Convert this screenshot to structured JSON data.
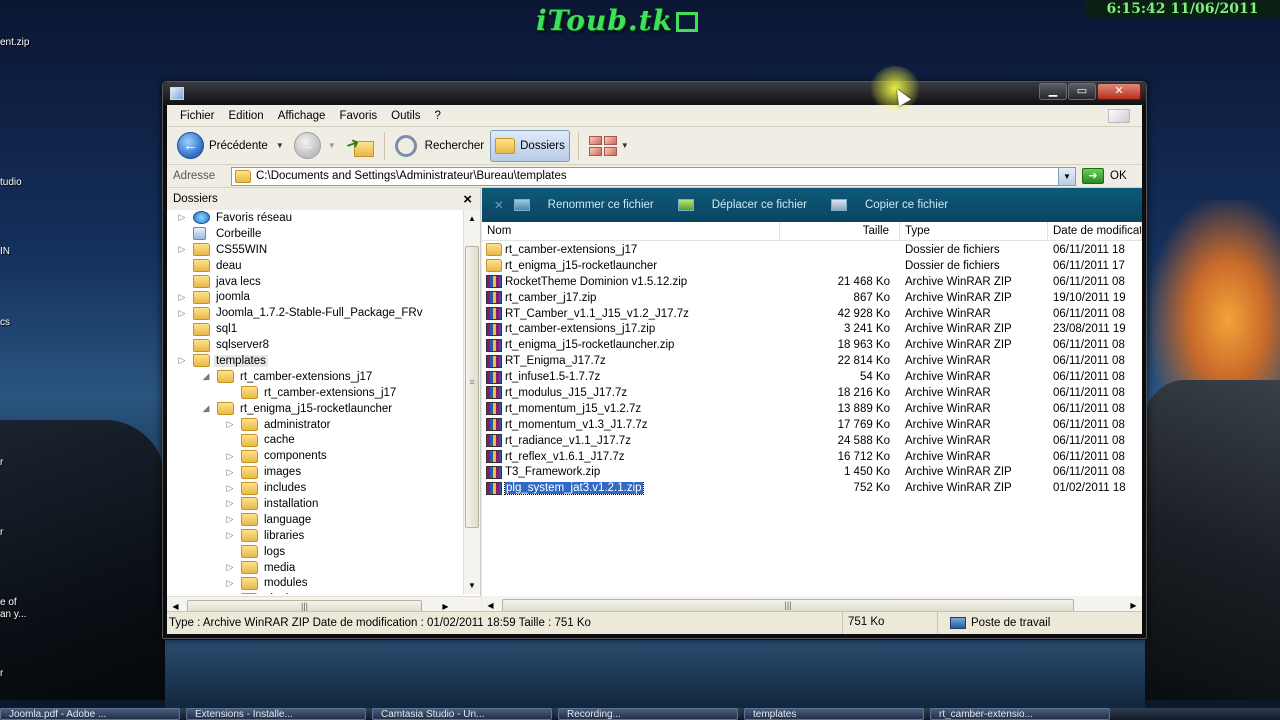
{
  "overlay": {
    "brand": "iToub.tk",
    "clock": "6:15:42  11/06/2011"
  },
  "desktop_labels": [
    "ent.zip",
    "tudio",
    "IN",
    "cs",
    "r",
    "r",
    "r",
    "e of",
    "an y...",
    "r"
  ],
  "window": {
    "menu": [
      "Fichier",
      "Edition",
      "Affichage",
      "Favoris",
      "Outils",
      "?"
    ],
    "toolbar": {
      "back": "Précédente",
      "search": "Rechercher",
      "folders": "Dossiers"
    },
    "address": {
      "label": "Adresse",
      "path": "C:\\Documents and Settings\\Administrateur\\Bureau\\templates",
      "go": "OK"
    },
    "left_pane": {
      "title": "Dossiers",
      "close": "×",
      "tree": [
        {
          "label": "Favoris réseau",
          "depth": 0,
          "exp": "▷",
          "icon": "net"
        },
        {
          "label": "Corbeille",
          "depth": 0,
          "exp": "",
          "icon": "bin"
        },
        {
          "label": "CS55WIN",
          "depth": 0,
          "exp": "▷",
          "icon": "folder"
        },
        {
          "label": "deau",
          "depth": 0,
          "exp": "",
          "icon": "folder"
        },
        {
          "label": "java lecs",
          "depth": 0,
          "exp": "",
          "icon": "folder"
        },
        {
          "label": "joomla",
          "depth": 0,
          "exp": "▷",
          "icon": "folder"
        },
        {
          "label": "Joomla_1.7.2-Stable-Full_Package_FRv",
          "depth": 0,
          "exp": "▷",
          "icon": "folder"
        },
        {
          "label": "sql1",
          "depth": 0,
          "exp": "",
          "icon": "folder"
        },
        {
          "label": "sqlserver8",
          "depth": 0,
          "exp": "",
          "icon": "folder"
        },
        {
          "label": "templates",
          "depth": 0,
          "exp": "▷",
          "icon": "folder",
          "selected": true
        },
        {
          "label": "rt_camber-extensions_j17",
          "depth": 1,
          "exp": "◢",
          "icon": "folder"
        },
        {
          "label": "rt_camber-extensions_j17",
          "depth": 2,
          "exp": "",
          "icon": "folder"
        },
        {
          "label": "rt_enigma_j15-rocketlauncher",
          "depth": 1,
          "exp": "◢",
          "icon": "folder"
        },
        {
          "label": "administrator",
          "depth": 2,
          "exp": "▷",
          "icon": "folder"
        },
        {
          "label": "cache",
          "depth": 2,
          "exp": "",
          "icon": "folder"
        },
        {
          "label": "components",
          "depth": 2,
          "exp": "▷",
          "icon": "folder"
        },
        {
          "label": "images",
          "depth": 2,
          "exp": "▷",
          "icon": "folder"
        },
        {
          "label": "includes",
          "depth": 2,
          "exp": "▷",
          "icon": "folder"
        },
        {
          "label": "installation",
          "depth": 2,
          "exp": "▷",
          "icon": "folder"
        },
        {
          "label": "language",
          "depth": 2,
          "exp": "▷",
          "icon": "folder"
        },
        {
          "label": "libraries",
          "depth": 2,
          "exp": "▷",
          "icon": "folder"
        },
        {
          "label": "logs",
          "depth": 2,
          "exp": "",
          "icon": "folder"
        },
        {
          "label": "media",
          "depth": 2,
          "exp": "▷",
          "icon": "folder"
        },
        {
          "label": "modules",
          "depth": 2,
          "exp": "▷",
          "icon": "folder"
        },
        {
          "label": "plugins",
          "depth": 2,
          "exp": "▷",
          "icon": "folder"
        }
      ]
    },
    "tasks": {
      "rename": "Renommer ce fichier",
      "move": "Déplacer ce fichier",
      "copy": "Copier ce fichier"
    },
    "columns": {
      "name": "Nom",
      "size": "Taille",
      "type": "Type",
      "date": "Date de modificatio"
    },
    "files": [
      {
        "name": "rt_camber-extensions_j17",
        "size": "",
        "type": "Dossier de fichiers",
        "date": "06/11/2011 18",
        "icon": "folder"
      },
      {
        "name": "rt_enigma_j15-rocketlauncher",
        "size": "",
        "type": "Dossier de fichiers",
        "date": "06/11/2011 17",
        "icon": "folder"
      },
      {
        "name": "RocketTheme Dominion v1.5.12.zip",
        "size": "21 468 Ko",
        "type": "Archive WinRAR ZIP",
        "date": "06/11/2011 08",
        "icon": "rar"
      },
      {
        "name": "rt_camber_j17.zip",
        "size": "867 Ko",
        "type": "Archive WinRAR ZIP",
        "date": "19/10/2011 19",
        "icon": "rar"
      },
      {
        "name": "RT_Camber_v1.1_J15_v1.2_J17.7z",
        "size": "42 928 Ko",
        "type": "Archive WinRAR",
        "date": "06/11/2011 08",
        "icon": "rar"
      },
      {
        "name": "rt_camber-extensions_j17.zip",
        "size": "3 241 Ko",
        "type": "Archive WinRAR ZIP",
        "date": "23/08/2011 19",
        "icon": "rar"
      },
      {
        "name": "rt_enigma_j15-rocketlauncher.zip",
        "size": "18 963 Ko",
        "type": "Archive WinRAR ZIP",
        "date": "06/11/2011 08",
        "icon": "rar"
      },
      {
        "name": "RT_Enigma_J17.7z",
        "size": "22 814 Ko",
        "type": "Archive WinRAR",
        "date": "06/11/2011 08",
        "icon": "rar"
      },
      {
        "name": "rt_infuse1.5-1.7.7z",
        "size": "54 Ko",
        "type": "Archive WinRAR",
        "date": "06/11/2011 08",
        "icon": "rar"
      },
      {
        "name": "rt_modulus_J15_J17.7z",
        "size": "18 216 Ko",
        "type": "Archive WinRAR",
        "date": "06/11/2011 08",
        "icon": "rar"
      },
      {
        "name": "rt_momentum_j15_v1.2.7z",
        "size": "13 889 Ko",
        "type": "Archive WinRAR",
        "date": "06/11/2011 08",
        "icon": "rar"
      },
      {
        "name": "rt_momentum_v1.3_J1.7.7z",
        "size": "17 769 Ko",
        "type": "Archive WinRAR",
        "date": "06/11/2011 08",
        "icon": "rar"
      },
      {
        "name": "rt_radiance_v1.1_J17.7z",
        "size": "24 588 Ko",
        "type": "Archive WinRAR",
        "date": "06/11/2011 08",
        "icon": "rar"
      },
      {
        "name": "rt_reflex_v1.6.1_J17.7z",
        "size": "16 712 Ko",
        "type": "Archive WinRAR",
        "date": "06/11/2011 08",
        "icon": "rar"
      },
      {
        "name": "T3_Framework.zip",
        "size": "1 450 Ko",
        "type": "Archive WinRAR ZIP",
        "date": "06/11/2011 08",
        "icon": "rar"
      },
      {
        "name": "plg_system_jat3.v1.2.1.zip",
        "size": "752 Ko",
        "type": "Archive WinRAR ZIP",
        "date": "01/02/2011 18",
        "icon": "rar",
        "selected": true
      }
    ],
    "status": {
      "details": "Type : Archive WinRAR ZIP Date de modification : 01/02/2011 18:59 Taille : 751 Ko",
      "size": "751 Ko",
      "zone": "Poste de travail"
    }
  },
  "taskbar_items": [
    "Joomla.pdf - Adobe ...",
    "Extensions - Installe...",
    "Camtasia Studio - Un...",
    "Recording...",
    "templates",
    "rt_camber-extensio..."
  ]
}
